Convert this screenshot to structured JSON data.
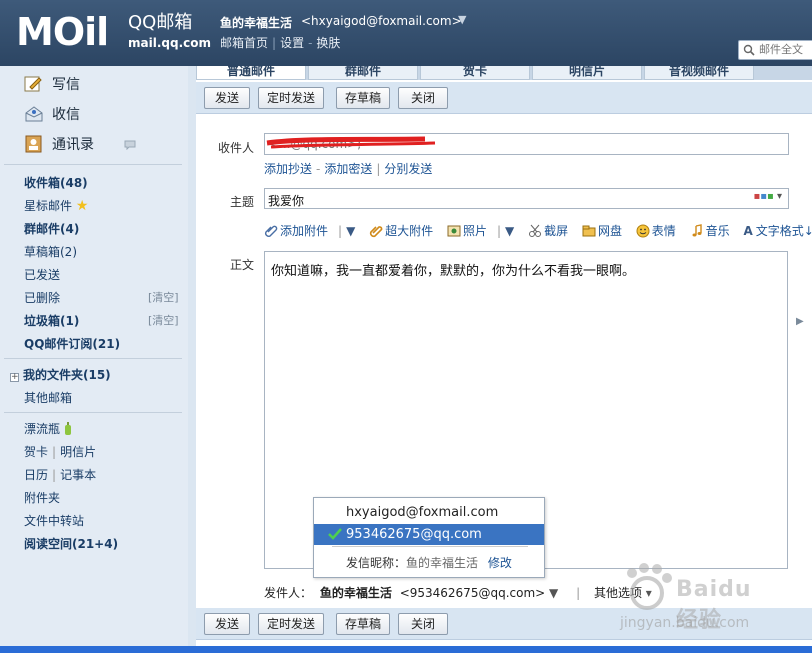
{
  "header": {
    "logo_main": "MOil",
    "logo_qq": "QQ邮箱",
    "logo_url": "mail.qq.com",
    "user_name": "鱼的幸福生活",
    "user_email": "<hxyaigod@foxmail.com>",
    "caret": "▼",
    "links": [
      "邮箱首页",
      "设置",
      "换肤"
    ],
    "search_placeholder": "邮件全文"
  },
  "sidebar": {
    "write": "写信",
    "receive": "收信",
    "contacts": "通讯录",
    "folders": [
      {
        "label": "收件箱(48)"
      },
      {
        "label": "星标邮件"
      },
      {
        "label": "群邮件(4)"
      },
      {
        "label": "草稿箱(2)"
      },
      {
        "label": "已发送"
      },
      {
        "label": "已删除"
      },
      {
        "label": "垃圾箱(1)"
      },
      {
        "label": "QQ邮件订阅(21)"
      }
    ],
    "clear_label": "[清空]",
    "my_folders": "我的文件夹(15)",
    "other_mailbox": "其他邮箱",
    "tools": [
      {
        "label": "漂流瓶"
      },
      {
        "label": "贺卡"
      },
      {
        "label": "明信片"
      },
      {
        "label": "日历"
      },
      {
        "label": "记事本"
      },
      {
        "label": "附件夹"
      },
      {
        "label": "文件中转站"
      },
      {
        "label": "阅读空间(21+4)"
      }
    ]
  },
  "tabs": [
    "普通邮件",
    "群邮件",
    "贺卡",
    "明信片",
    "音视频邮件"
  ],
  "toolbar": {
    "send": "发送",
    "timed_send": "定时发送",
    "save_draft": "存草稿",
    "close": "关闭"
  },
  "compose": {
    "to_label": "收件人",
    "to_value": "<...@qq.com>;",
    "add_cc": "添加抄送",
    "add_bcc": "添加密送",
    "separate_send": "分别发送",
    "subject_label": "主题",
    "subject_value": "我爱你",
    "body_label": "正文",
    "body_value": "你知道嘛，我一直都爱着你，默默的，你为什么不看我一眼啊。"
  },
  "attach_bar": {
    "add_attachment": "添加附件",
    "big_attachment": "超大附件",
    "photo": "照片",
    "screenshot": "截屏",
    "netdisk": "网盘",
    "emoji": "表情",
    "music": "音乐",
    "text_format": "文字格式"
  },
  "sender": {
    "label": "发件人：",
    "name": "鱼的幸福生活",
    "address": "<953462675@qq.com>",
    "other_options": "其他选项"
  },
  "dropdown": {
    "options": [
      "hxyaigod@foxmail.com",
      "953462675@qq.com"
    ],
    "selected_index": 1,
    "nick_label": "发信昵称：",
    "nick_value": "鱼的幸福生活",
    "modify": "修改"
  },
  "watermark": {
    "text": "Baidu 经验",
    "url": "jingyan.baidu.com"
  },
  "colors": {
    "header_bg": "#2c4563",
    "selected_bg": "#3a74c2",
    "link": "#1e5494",
    "redaction": "#e02020"
  }
}
